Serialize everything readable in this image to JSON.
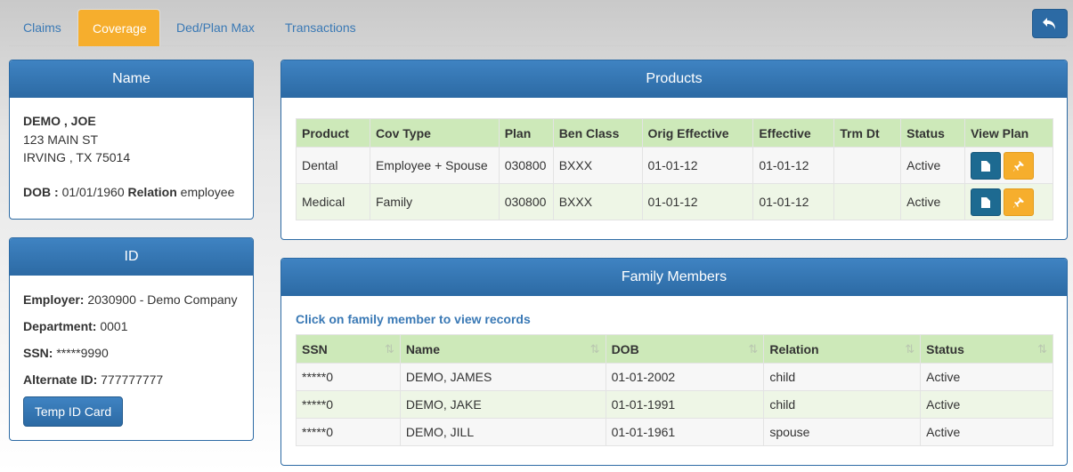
{
  "tabs": [
    {
      "label": "Claims",
      "active": false
    },
    {
      "label": "Coverage",
      "active": true
    },
    {
      "label": "Ded/Plan Max",
      "active": false
    },
    {
      "label": "Transactions",
      "active": false
    }
  ],
  "back_button_icon": "undo-arrow-icon",
  "name_panel": {
    "title": "Name",
    "member_name": "DEMO , JOE",
    "address1": "123 MAIN ST",
    "address2": "IRVING , TX 75014",
    "dob_label": "DOB :",
    "dob_value": "01/01/1960",
    "relation_label": "Relation",
    "relation_value": "employee"
  },
  "id_panel": {
    "title": "ID",
    "employer_label": "Employer:",
    "employer_value": "2030900 - Demo Company",
    "department_label": "Department:",
    "department_value": "0001",
    "ssn_label": "SSN:",
    "ssn_value": "*****9990",
    "alt_id_label": "Alternate ID:",
    "alt_id_value": "777777777",
    "temp_id_button": "Temp ID Card"
  },
  "products": {
    "title": "Products",
    "columns": [
      "Product",
      "Cov Type",
      "Plan",
      "Ben Class",
      "Orig Effective",
      "Effective",
      "Trm Dt",
      "Status",
      "View Plan"
    ],
    "rows": [
      {
        "product": "Dental",
        "cov_type": "Employee + Spouse",
        "plan": "030800",
        "ben_class": "BXXX",
        "orig_effective": "01-01-12",
        "effective": "01-01-12",
        "trm_dt": "",
        "status": "Active"
      },
      {
        "product": "Medical",
        "cov_type": "Family",
        "plan": "030800",
        "ben_class": "BXXX",
        "orig_effective": "01-01-12",
        "effective": "01-01-12",
        "trm_dt": "",
        "status": "Active"
      }
    ],
    "icons": {
      "doc": "document-icon",
      "pin": "pin-icon"
    }
  },
  "family": {
    "title": "Family Members",
    "hint": "Click on family member to view records",
    "columns": [
      "SSN",
      "Name",
      "DOB",
      "Relation",
      "Status"
    ],
    "rows": [
      {
        "ssn": "*****0",
        "name": "DEMO, JAMES",
        "dob": "01-01-2002",
        "relation": "child",
        "status": "Active"
      },
      {
        "ssn": "*****0",
        "name": "DEMO, JAKE",
        "dob": "01-01-1991",
        "relation": "child",
        "status": "Active"
      },
      {
        "ssn": "*****0",
        "name": "DEMO, JILL",
        "dob": "01-01-1961",
        "relation": "spouse",
        "status": "Active"
      }
    ]
  },
  "colors": {
    "accent_orange": "#f6ae2d",
    "panel_blue": "#2c6aa4",
    "header_green": "#cde9b9",
    "link_blue": "#3a79b5"
  }
}
